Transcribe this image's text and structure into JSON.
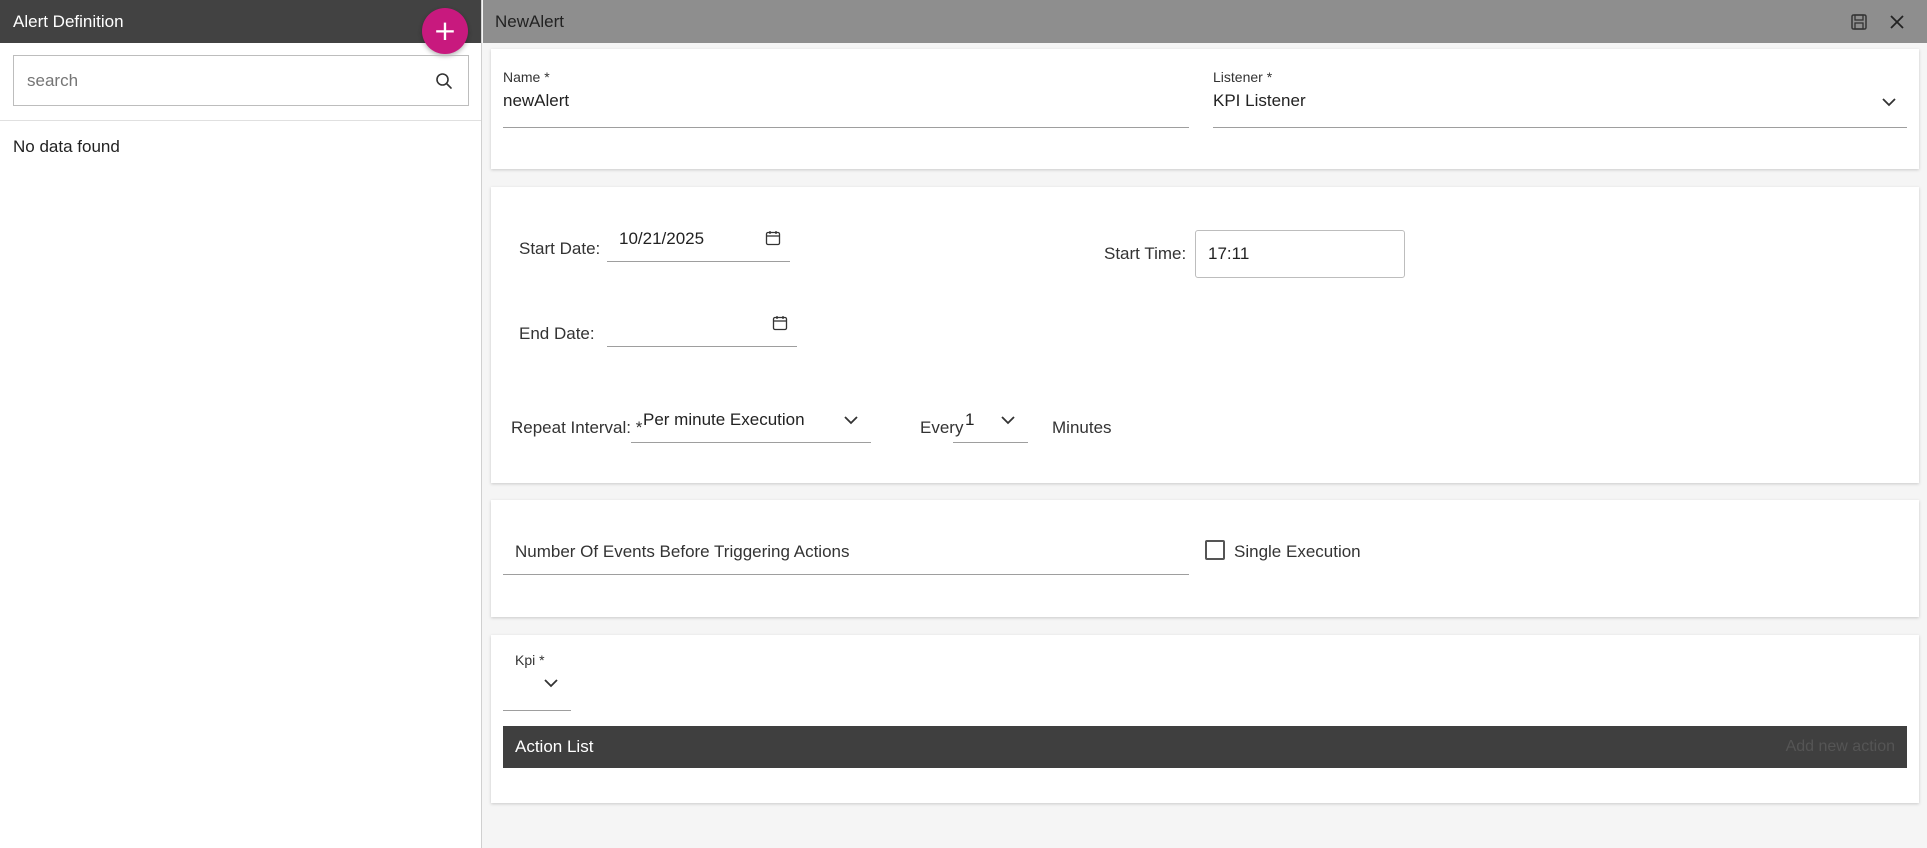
{
  "sidebar": {
    "title": "Alert Definition",
    "add_button": "+",
    "search_placeholder": "search",
    "empty_text": "No data found"
  },
  "editor": {
    "title": "NewAlert",
    "name": {
      "label": "Name *",
      "value": "newAlert"
    },
    "listener": {
      "label": "Listener *",
      "value": "KPI Listener"
    },
    "start_date": {
      "label": "Start Date:",
      "value": "10/21/2025"
    },
    "start_time": {
      "label": "Start Time:",
      "value": "17:11"
    },
    "end_date": {
      "label": "End Date:",
      "value": ""
    },
    "repeat_interval": {
      "label": "Repeat Interval: *",
      "value": "Per minute Execution"
    },
    "every": {
      "label": "Every",
      "value": "1",
      "unit": "Minutes"
    },
    "events_before_trigger": {
      "placeholder": "Number Of Events Before Triggering Actions"
    },
    "single_execution": {
      "label": "Single Execution",
      "checked": false
    },
    "kpi": {
      "label": "Kpi *",
      "value": ""
    },
    "action_list": {
      "title": "Action List",
      "add_label": "Add new action"
    }
  },
  "colors": {
    "fab": "#c8197e",
    "sidebar_header": "#424242",
    "editor_header": "#8e8e8e",
    "action_bar": "#3f3f3f"
  }
}
